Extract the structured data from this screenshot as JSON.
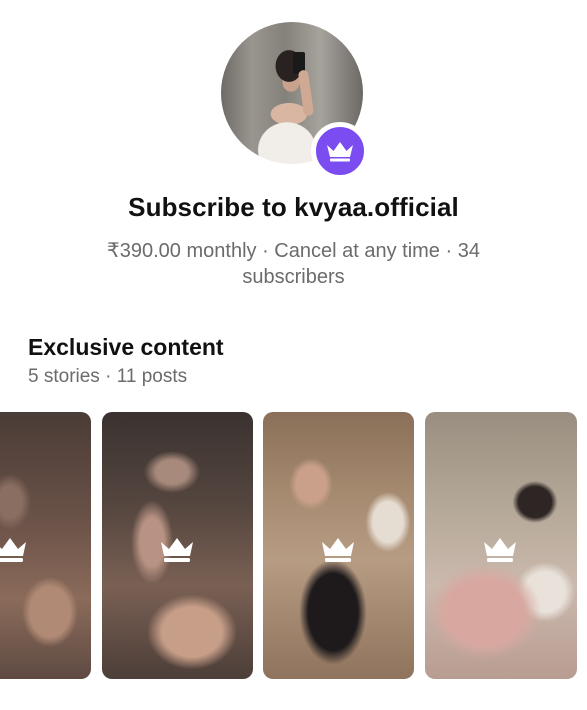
{
  "profile": {
    "avatar_alt": "Profile photo",
    "badge_icon": "crown-icon",
    "accent_color": "#7b4cf0"
  },
  "subscribe": {
    "title": "Subscribe to kvyaa.official",
    "price_line": "₹390.00 monthly · Cancel at any time · 34 subscribers"
  },
  "exclusive": {
    "title": "Exclusive content",
    "counts": "5 stories · 11 posts",
    "thumbnails": [
      {
        "icon": "crown-icon"
      },
      {
        "icon": "crown-icon"
      },
      {
        "icon": "crown-icon"
      },
      {
        "icon": "crown-icon"
      }
    ]
  }
}
